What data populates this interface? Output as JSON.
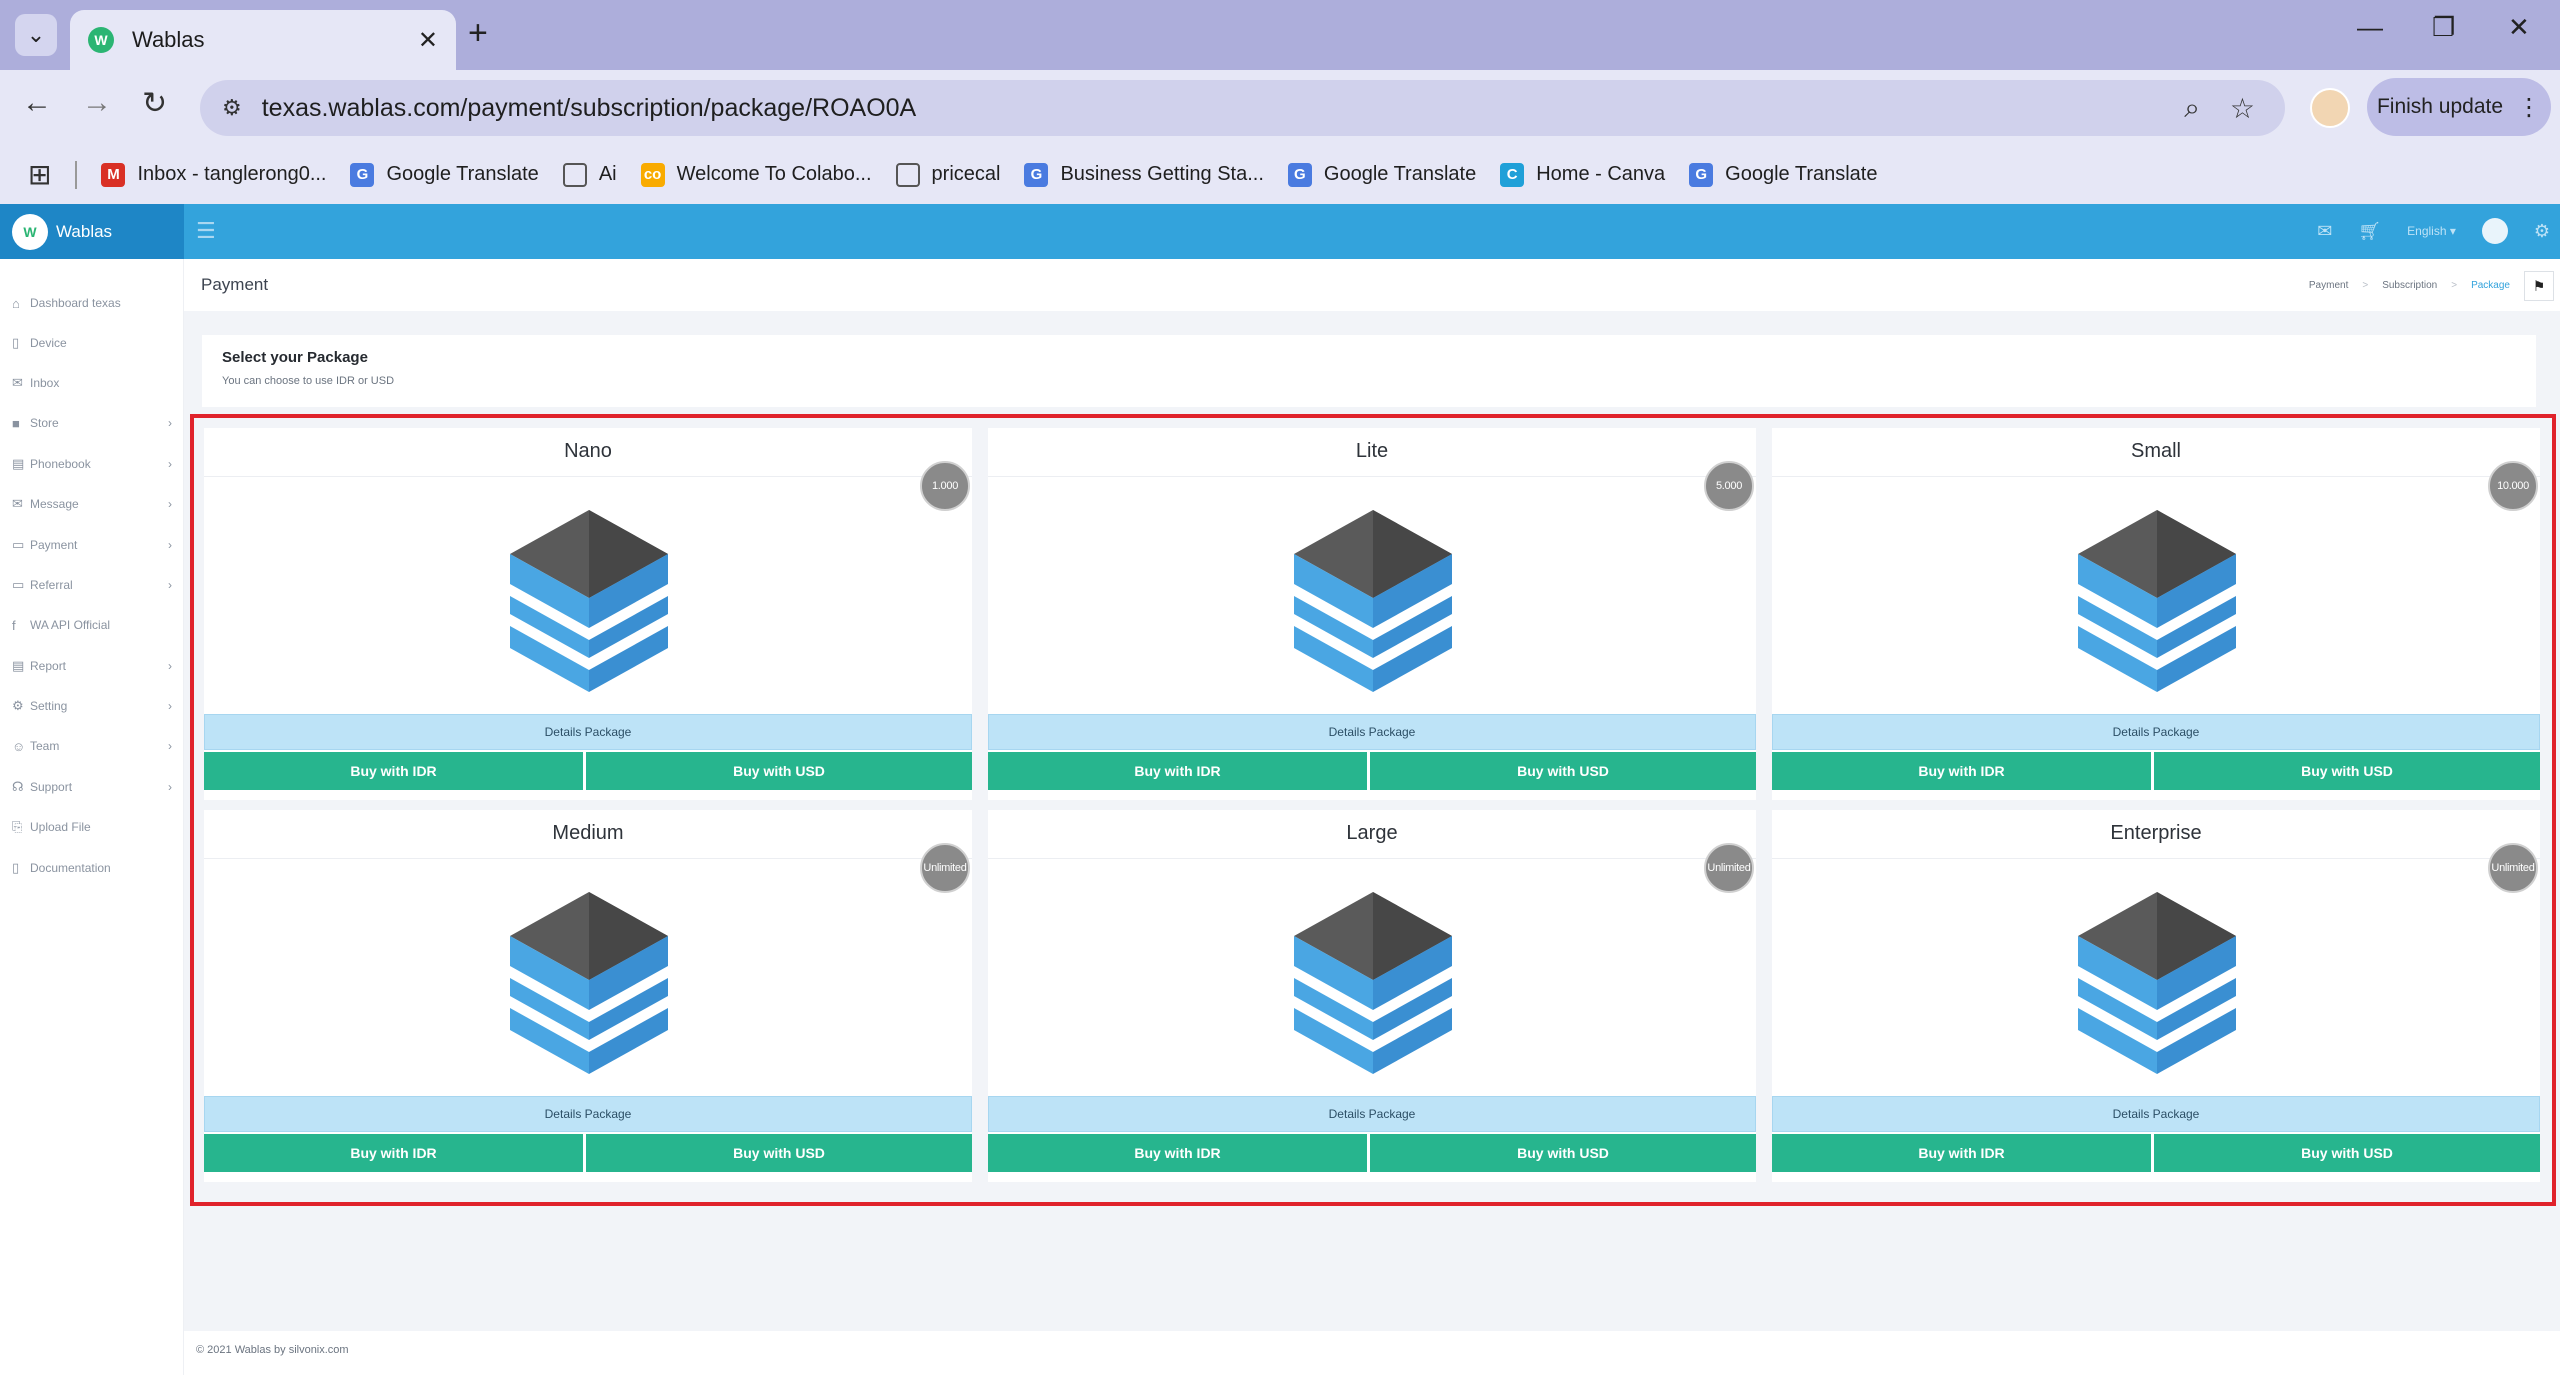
{
  "browser": {
    "tab_title": "Wablas",
    "tab_close": "✕",
    "new_tab": "+",
    "url": "texas.wablas.com/payment/subscription/package/ROAO0A",
    "finish_update": "Finish update",
    "bookmarks": [
      {
        "label": "Inbox - tanglerong0...",
        "icon": "gmail-icon",
        "color": "#d93025",
        "glyph": "M"
      },
      {
        "label": "Google Translate",
        "icon": "translate-icon",
        "color": "#4a7be0",
        "glyph": "G"
      },
      {
        "label": "Ai",
        "icon": "folder-icon",
        "color": "#e6e7f6",
        "glyph": "▭"
      },
      {
        "label": "Welcome To Colabo...",
        "icon": "colab-icon",
        "color": "#f9ab00",
        "glyph": "co"
      },
      {
        "label": "pricecal",
        "icon": "folder-icon",
        "color": "#e6e7f6",
        "glyph": "▭"
      },
      {
        "label": "Business Getting Sta...",
        "icon": "translate-icon",
        "color": "#4a7be0",
        "glyph": "G"
      },
      {
        "label": "Google Translate",
        "icon": "translate-icon",
        "color": "#4a7be0",
        "glyph": "G"
      },
      {
        "label": "Home - Canva",
        "icon": "canva-icon",
        "color": "#1fa0d8",
        "glyph": "C"
      },
      {
        "label": "Google Translate",
        "icon": "translate-icon",
        "color": "#4a7be0",
        "glyph": "G"
      }
    ]
  },
  "app": {
    "logo_text": "Wablas",
    "language": "English ▾",
    "sidebar": [
      {
        "label": "Dashboard texas",
        "icon": "⌂",
        "has_arrow": false
      },
      {
        "label": "Device",
        "icon": "▯",
        "has_arrow": false
      },
      {
        "label": "Inbox",
        "icon": "✉",
        "has_arrow": false
      },
      {
        "label": "Store",
        "icon": "■",
        "has_arrow": true
      },
      {
        "label": "Phonebook",
        "icon": "▤",
        "has_arrow": true
      },
      {
        "label": "Message",
        "icon": "✉",
        "has_arrow": true
      },
      {
        "label": "Payment",
        "icon": "▭",
        "has_arrow": true
      },
      {
        "label": "Referral",
        "icon": "▭",
        "has_arrow": true
      },
      {
        "label": "WA API Official",
        "icon": "f",
        "has_arrow": false
      },
      {
        "label": "Report",
        "icon": "▤",
        "has_arrow": true
      },
      {
        "label": "Setting",
        "icon": "⚙",
        "has_arrow": true
      },
      {
        "label": "Team",
        "icon": "☺",
        "has_arrow": true
      },
      {
        "label": "Support",
        "icon": "☊",
        "has_arrow": true
      },
      {
        "label": "Upload File",
        "icon": "⎘",
        "has_arrow": false
      },
      {
        "label": "Documentation",
        "icon": "▯",
        "has_arrow": false
      }
    ],
    "page_title": "Payment",
    "breadcrumb": [
      "Payment",
      "Subscription",
      "Package"
    ],
    "select_title": "Select your Package",
    "select_subtitle": "You can choose to use IDR or USD",
    "footer": "© 2021 Wablas by silvonix.com"
  },
  "packages": [
    {
      "name": "Nano",
      "quota": "1.000",
      "details": "Details Package",
      "buy_idr": "Buy with IDR",
      "buy_usd": "Buy with USD"
    },
    {
      "name": "Lite",
      "quota": "5.000",
      "details": "Details Package",
      "buy_idr": "Buy with IDR",
      "buy_usd": "Buy with USD"
    },
    {
      "name": "Small",
      "quota": "10.000",
      "details": "Details Package",
      "buy_idr": "Buy with IDR",
      "buy_usd": "Buy with USD"
    },
    {
      "name": "Medium",
      "quota": "Unlimited",
      "details": "Details Package",
      "buy_idr": "Buy with IDR",
      "buy_usd": "Buy with USD"
    },
    {
      "name": "Large",
      "quota": "Unlimited",
      "details": "Details Package",
      "buy_idr": "Buy with IDR",
      "buy_usd": "Buy with USD"
    },
    {
      "name": "Enterprise",
      "quota": "Unlimited",
      "details": "Details Package",
      "buy_idr": "Buy with IDR",
      "buy_usd": "Buy with USD"
    }
  ],
  "colors": {
    "header": "#33a3dc",
    "buy_button": "#27b58e",
    "details_button": "#bde3f7",
    "highlight_border": "#e0222b"
  }
}
